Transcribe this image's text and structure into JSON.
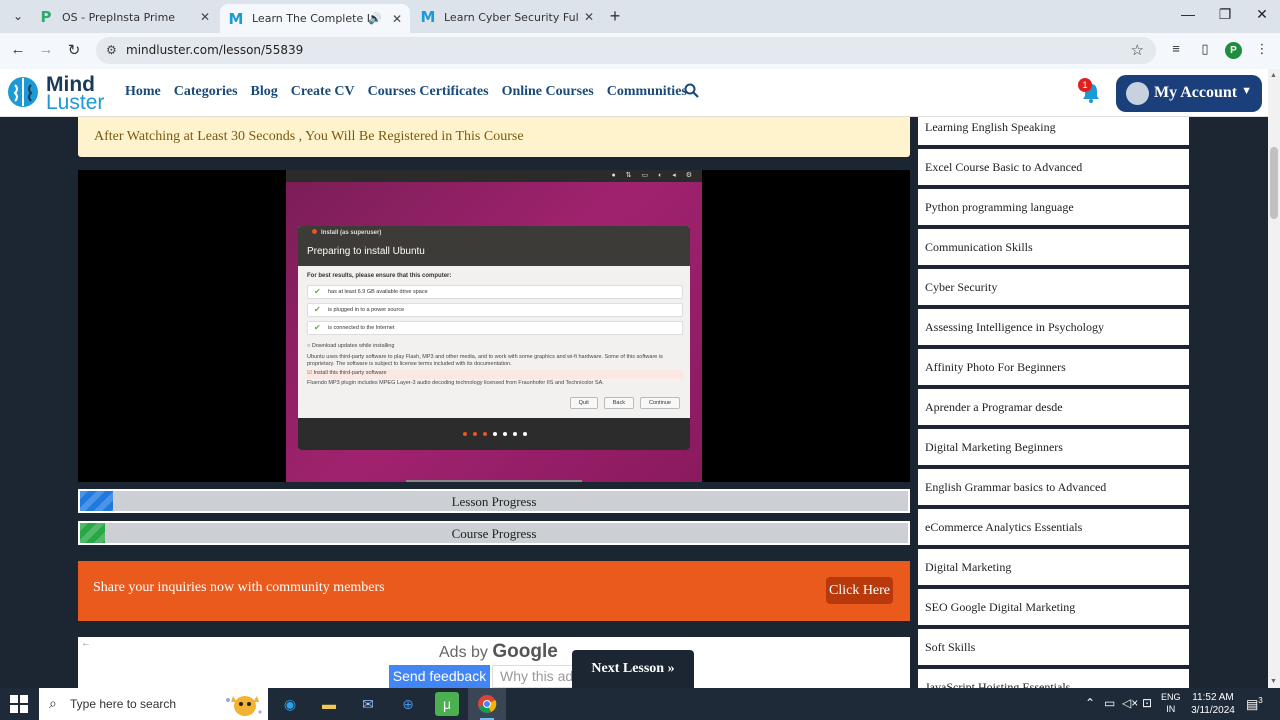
{
  "browser": {
    "tabs": [
      {
        "title": "OS - PrepInsta Prime",
        "fav_glyph": "P",
        "fav_color": "#2fa96e"
      },
      {
        "title": "Learn The Complete Linux C",
        "fav_glyph": "M",
        "fav_color": "#1b9ad6"
      },
      {
        "title": "Learn Cyber Security Full course",
        "fav_glyph": "M",
        "fav_color": "#1b9ad6"
      }
    ],
    "url": "mindluster.com/lesson/55839",
    "profile_initial": "P"
  },
  "site": {
    "logo_line1": "Mind",
    "logo_line2": "Luster",
    "nav": [
      "Home",
      "Categories",
      "Blog",
      "Create CV",
      "Courses Certificates",
      "Online Courses",
      "Communities"
    ],
    "notification_count": "1",
    "account_label": "My Account"
  },
  "notice": "After Watching at Least 30 Seconds , You Will Be Registered in This Course",
  "video": {
    "window_title": "Install (as superuser)",
    "heading": "Preparing to install Ubuntu",
    "intro": "For best results, please ensure that this computer:",
    "checks": [
      "has at least 6.9 GB available drive space",
      "is plugged in to a power source",
      "is connected to the Internet"
    ],
    "download_option": "Download updates while installing",
    "third_party_text": "Ubuntu uses third-party software to play Flash, MP3 and other media, and to work with some graphics and wi-fi hardware. Some of this software is proprietary. The software is subject to license terms included with its documentation.",
    "third_party_option": "Install this third-party software",
    "third_party_note": "Fluendo MP3 plugin includes MPEG Layer-3 audio decoding technology licensed from Fraunhofer IIS and Technicolor SA.",
    "buttons": [
      "Quit",
      "Back",
      "Continue"
    ]
  },
  "progress": {
    "lesson_label": "Lesson Progress",
    "lesson_fraction": 0.04,
    "lesson_color": "#1f7ae0",
    "course_label": "Course Progress",
    "course_fraction": 0.03,
    "course_color": "#28a745"
  },
  "inquiry": {
    "message": "Share your inquiries now with community members",
    "button": "Click Here"
  },
  "ad": {
    "ads_by": "Ads by",
    "google": "Google",
    "feedback": "Send feedback",
    "why": "Why this ad?"
  },
  "next_lesson": "Next Lesson »",
  "sidebar": [
    "Learning English Speaking",
    "Excel Course Basic to Advanced",
    "Python programming language",
    "Communication Skills",
    "Cyber Security",
    "Assessing Intelligence in Psychology",
    "Affinity Photo For Beginners",
    "Aprender a Programar desde",
    "Digital Marketing Beginners",
    "English Grammar basics to Advanced",
    "eCommerce Analytics Essentials",
    "Digital Marketing",
    "SEO Google Digital Marketing",
    "Soft Skills",
    "JavaScript Hoisting Essentials"
  ],
  "taskbar": {
    "search_placeholder": "Type here to search",
    "lang_line1": "ENG",
    "lang_line2": "IN",
    "time": "11:52 AM",
    "date": "3/11/2024",
    "notif_count": "3"
  }
}
